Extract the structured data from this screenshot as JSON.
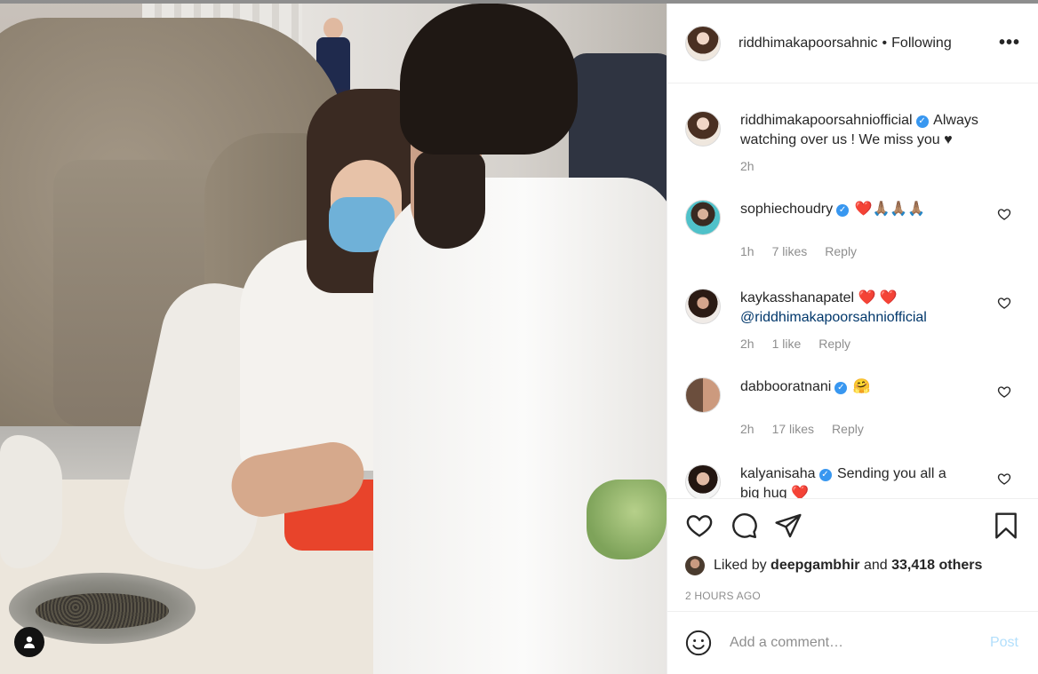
{
  "photo": {
    "tag_icon": "user-icon"
  },
  "header": {
    "username": "riddhimakapoorsahnic",
    "separator": "•",
    "follow_status": "Following",
    "more_icon": "more-horizontal-icon",
    "more_label": "•••"
  },
  "caption": {
    "username": "riddhimakapoorsahniofficial",
    "verified": true,
    "text": "Always watching over us ! We miss you ♥",
    "time": "2h"
  },
  "comments": [
    {
      "username": "sophiechoudry",
      "verified": true,
      "text": "❤️🙏🏽🙏🏽🙏🏽",
      "time": "1h",
      "likes": "7 likes",
      "reply": "Reply"
    },
    {
      "username": "kaykasshanapatel",
      "verified": false,
      "text": "❤️ ❤️",
      "mention": "@riddhimakapoorsahniofficial",
      "time": "2h",
      "likes": "1 like",
      "reply": "Reply"
    },
    {
      "username": "dabbooratnani",
      "verified": true,
      "text": "🤗",
      "time": "2h",
      "likes": "17 likes",
      "reply": "Reply"
    },
    {
      "username": "kalyanisaha",
      "verified": true,
      "text_a": "Sending you all a",
      "text_b": "big hug",
      "heart": "❤️"
    }
  ],
  "actions": {
    "like_icon": "heart-icon",
    "comment_icon": "comment-icon",
    "share_icon": "send-icon",
    "save_icon": "bookmark-icon"
  },
  "likes": {
    "prefix": "Liked by",
    "user": "deepgambhir",
    "middle": "and",
    "others": "33,418 others"
  },
  "timestamp": "2 HOURS AGO",
  "add_comment": {
    "emoji_icon": "smiley-icon",
    "placeholder": "Add a comment…",
    "post_label": "Post"
  },
  "colors": {
    "verified": "#3897f0",
    "post_disabled": "#b2dffc",
    "meta_gray": "#8e8e8e",
    "heart_red": "#ed4956"
  }
}
